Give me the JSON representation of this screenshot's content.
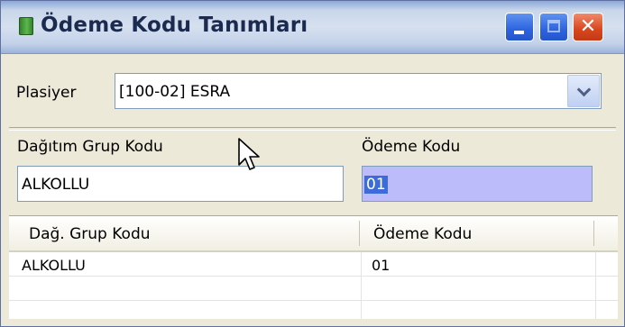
{
  "window": {
    "title": "Ödeme Kodu Tanımları",
    "buttons": [
      "minimize",
      "maximize",
      "close"
    ],
    "close_glyph": "✕"
  },
  "plasiyer": {
    "label": "Plasiyer",
    "value": "[100-02] ESRA"
  },
  "form": {
    "group_label": "Dağıtım Grup Kodu",
    "group_value": "ALKOLLU",
    "payment_label": "Ödeme Kodu",
    "payment_value": "01"
  },
  "grid": {
    "columns": [
      "Dağ. Grup Kodu",
      "Ödeme Kodu"
    ],
    "rows": [
      [
        "ALKOLLU",
        "01"
      ],
      [
        "",
        ""
      ],
      [
        "",
        ""
      ]
    ]
  },
  "colors": {
    "titlebar": "#c9d6ea",
    "title_text": "#1b2a4f",
    "selection": "#3d6bd8",
    "highlight_field": "#bcbcfa",
    "close_button": "#d8461e"
  },
  "icons": [
    "app-icon",
    "chevron-down-icon",
    "mouse-cursor-icon"
  ]
}
